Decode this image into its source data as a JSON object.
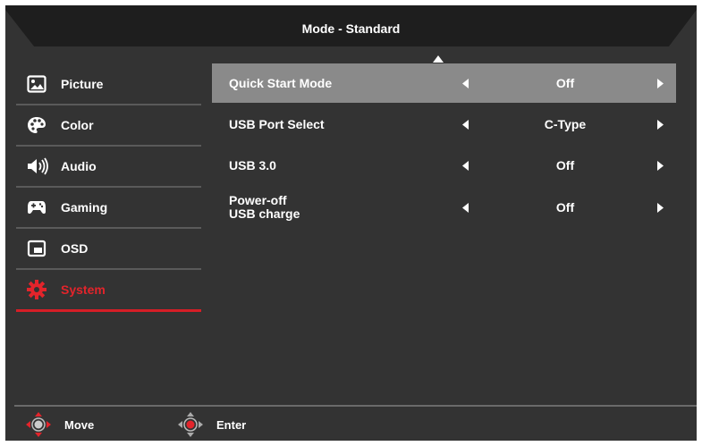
{
  "header": {
    "title": "Mode - Standard"
  },
  "sidebar": {
    "items": [
      {
        "label": "Picture",
        "icon": "picture-icon"
      },
      {
        "label": "Color",
        "icon": "palette-icon"
      },
      {
        "label": "Audio",
        "icon": "speaker-icon"
      },
      {
        "label": "Gaming",
        "icon": "gamepad-icon"
      },
      {
        "label": "OSD",
        "icon": "osd-window-icon"
      },
      {
        "label": "System",
        "icon": "gear-icon",
        "active": true
      }
    ]
  },
  "settings": [
    {
      "label": "Quick Start Mode",
      "value": "Off",
      "selected": true
    },
    {
      "label": "USB Port Select",
      "value": "C-Type"
    },
    {
      "label": "USB 3.0",
      "value": "Off"
    },
    {
      "label": "Power-off\nUSB charge",
      "value": "Off"
    }
  ],
  "footer": {
    "move_label": "Move",
    "enter_label": "Enter"
  },
  "colors": {
    "background": "#333333",
    "accent": "#e3242b",
    "selected_row": "#8a8a8a"
  }
}
